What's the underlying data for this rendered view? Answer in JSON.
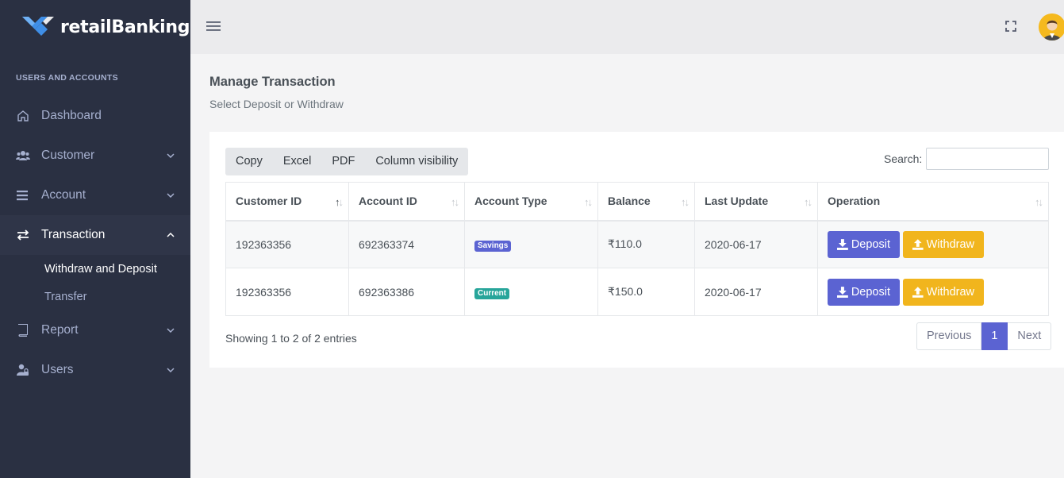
{
  "brand": {
    "name": "retailBanking"
  },
  "sidebar": {
    "section_title": "USERS AND ACCOUNTS",
    "items": [
      {
        "label": "Dashboard",
        "icon": "home-icon"
      },
      {
        "label": "Customer",
        "icon": "users-icon"
      },
      {
        "label": "Account",
        "icon": "bars-icon"
      },
      {
        "label": "Transaction",
        "icon": "exchange-icon"
      },
      {
        "label": "Report",
        "icon": "book-icon"
      },
      {
        "label": "Users",
        "icon": "user-lock-icon"
      }
    ],
    "transaction_submenu": [
      {
        "label": "Withdraw and Deposit"
      },
      {
        "label": "Transfer"
      }
    ]
  },
  "page": {
    "title": "Manage Transaction",
    "subtitle": "Select Deposit or Withdraw"
  },
  "toolbar": {
    "buttons": [
      "Copy",
      "Excel",
      "PDF",
      "Column visibility"
    ],
    "search_label": "Search:",
    "search_value": ""
  },
  "table": {
    "columns": [
      "Customer ID",
      "Account ID",
      "Account Type",
      "Balance",
      "Last Update",
      "Operation"
    ],
    "rows": [
      {
        "customer_id": "192363356",
        "account_id": "692363374",
        "account_type": "Savings",
        "balance": "₹110.0",
        "last_update": "2020-06-17"
      },
      {
        "customer_id": "192363356",
        "account_id": "692363386",
        "account_type": "Current",
        "balance": "₹150.0",
        "last_update": "2020-06-17"
      }
    ],
    "deposit_label": "Deposit",
    "withdraw_label": "Withdraw"
  },
  "footer": {
    "info": "Showing 1 to 2 of 2 entries",
    "previous": "Previous",
    "page": "1",
    "next": "Next"
  },
  "colors": {
    "sidebar_bg": "#2a3042",
    "primary": "#5b63d2",
    "warning": "#f1b51d",
    "success": "#27a59a"
  }
}
